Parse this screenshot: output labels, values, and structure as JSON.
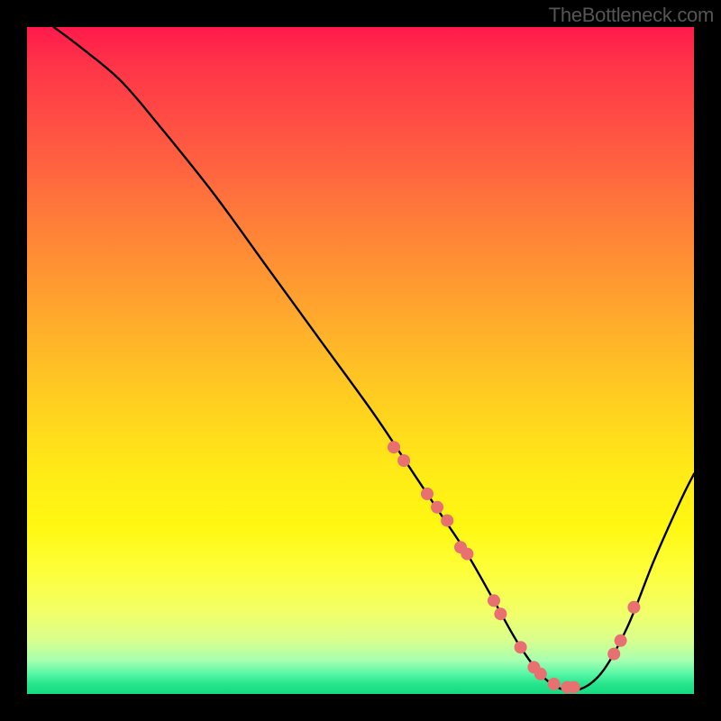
{
  "watermark": "TheBottleneck.com",
  "chart_data": {
    "type": "line",
    "title": "",
    "xlabel": "",
    "ylabel": "",
    "xlim": [
      0,
      100
    ],
    "ylim": [
      0,
      100
    ],
    "grid": false,
    "gradient_colors": {
      "top": "#ff1a4c",
      "mid": "#ffe917",
      "bottom": "#16d97f"
    },
    "series": [
      {
        "name": "bottleneck-curve",
        "type": "line",
        "color": "#000000",
        "x": [
          4,
          8,
          14,
          20,
          28,
          36,
          44,
          52,
          58,
          62,
          66,
          70,
          74,
          78,
          82,
          86,
          90,
          94,
          98,
          100
        ],
        "y": [
          100,
          97,
          92,
          85,
          75,
          64,
          53,
          42,
          33,
          27,
          21,
          14,
          7,
          2,
          0.5,
          3,
          10,
          20,
          29,
          33
        ]
      },
      {
        "name": "highlight-points",
        "type": "scatter",
        "color": "#e87070",
        "x": [
          55,
          56.5,
          60,
          61.5,
          63,
          65,
          66,
          70,
          71,
          74,
          76,
          77,
          79,
          81,
          82,
          88,
          89,
          91
        ],
        "y": [
          37,
          35,
          30,
          28,
          26,
          22,
          21,
          14,
          12,
          7,
          4,
          3,
          1.5,
          1,
          1,
          6,
          8,
          13
        ]
      }
    ]
  }
}
